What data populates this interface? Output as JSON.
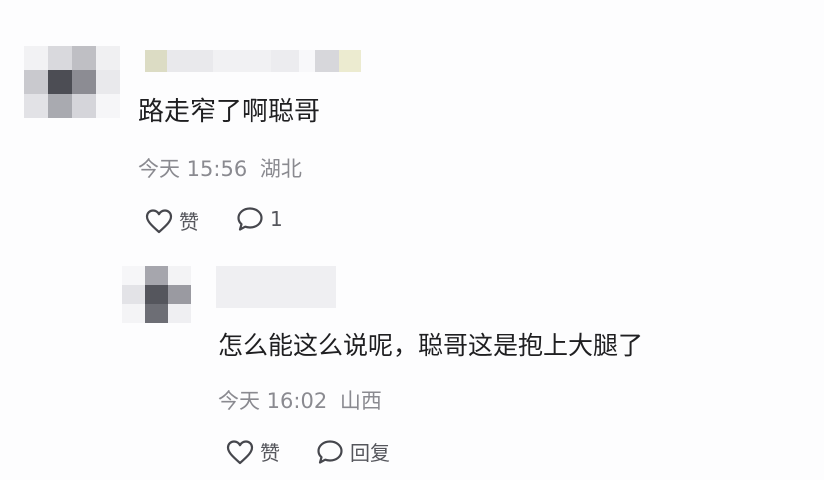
{
  "comment1": {
    "text": "路走窄了啊聪哥",
    "time": "今天 15:56",
    "location": "湖北",
    "like_label": "赞",
    "reply_count": "1"
  },
  "reply1": {
    "text": "怎么能这么说呢，聪哥这是抱上大腿了",
    "time": "今天 16:02",
    "location": "山西",
    "like_label": "赞",
    "reply_label": "回复"
  },
  "icons": {
    "like": "heart-outline-icon",
    "comment": "speech-bubble-icon"
  }
}
